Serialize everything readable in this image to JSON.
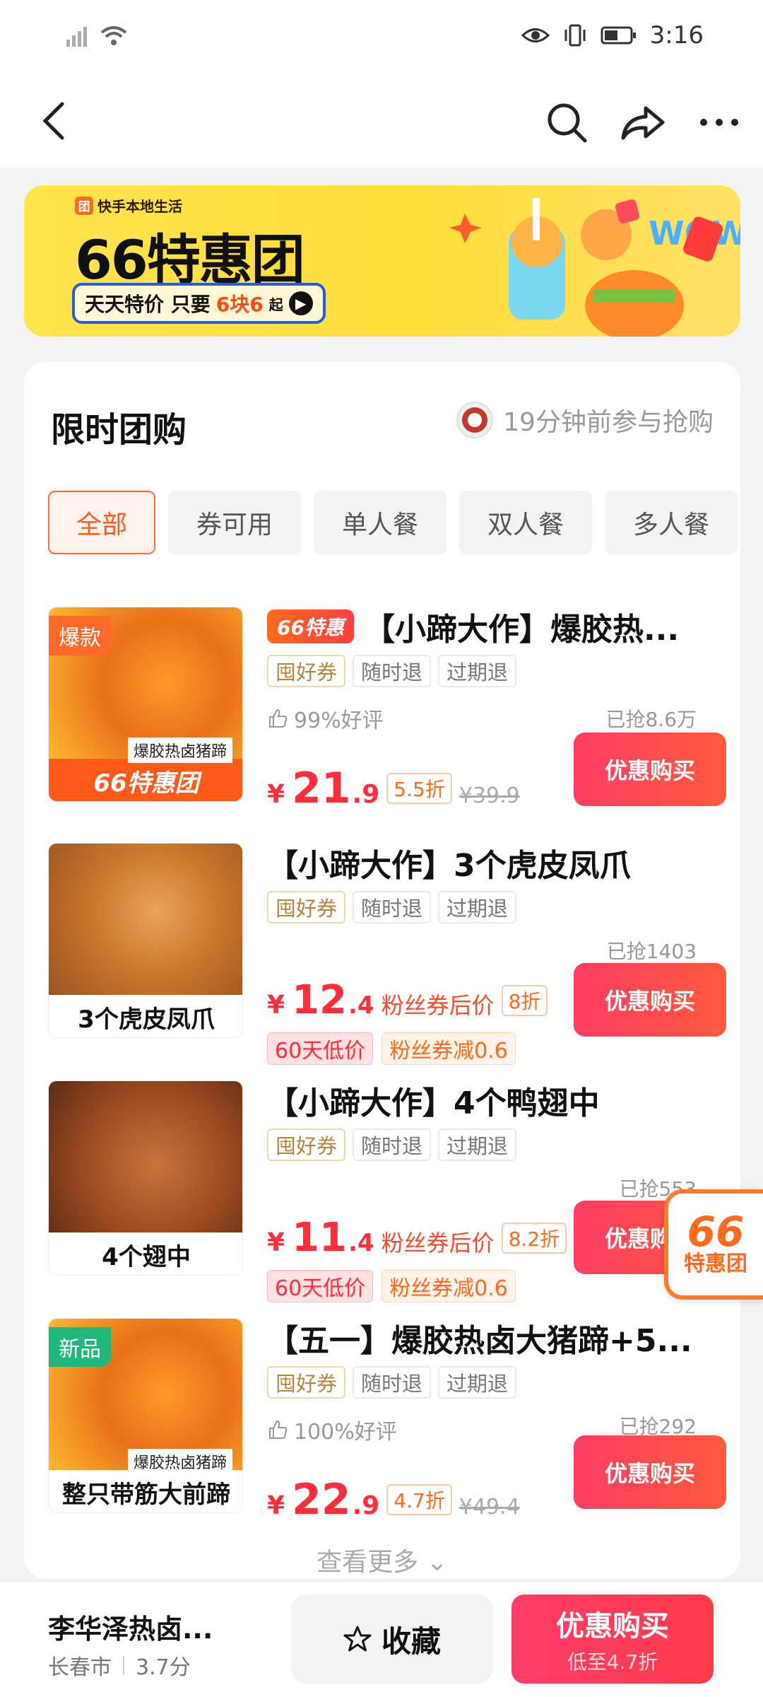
{
  "status": {
    "time": "3:16"
  },
  "banner": {
    "brand": "快手本地生活",
    "brand_icon": "团",
    "title": "66特惠团",
    "sub_prefix": "天天特价 只要",
    "sub_highlight": "6块6",
    "sub_suffix": "起"
  },
  "section": {
    "title": "限时团购",
    "recent": "19分钟前参与抢购"
  },
  "filters": [
    "全部",
    "券可用",
    "单人餐",
    "双人餐",
    "多人餐"
  ],
  "items": [
    {
      "promo": "66特惠",
      "title": "【小蹄大作】爆胶热...",
      "tags": [
        "囤好券",
        "随时退",
        "过期退"
      ],
      "rating": "99%好评",
      "grabbed": "已抢8.6万",
      "price_int": "21",
      "price_dec": ".9",
      "discount": "5.5折",
      "original": "¥39.9",
      "badge": "爆款",
      "sub_caption": "爆胶热卤猪蹄",
      "caption": "66特惠团",
      "buy": "优惠购买"
    },
    {
      "title": "【小蹄大作】3个虎皮凤爪",
      "tags": [
        "囤好券",
        "随时退",
        "过期退"
      ],
      "grabbed": "已抢1403",
      "price_int": "12",
      "price_dec": ".4",
      "fan_label": "粉丝券后价",
      "discount": "8折",
      "low": "60天低价",
      "coupon": "粉丝券减0.6",
      "caption": "3个虎皮凤爪",
      "buy": "优惠购买"
    },
    {
      "title": "【小蹄大作】4个鸭翅中",
      "tags": [
        "囤好券",
        "随时退",
        "过期退"
      ],
      "grabbed": "已抢553",
      "price_int": "11",
      "price_dec": ".4",
      "fan_label": "粉丝券后价",
      "discount": "8.2折",
      "low": "60天低价",
      "coupon": "粉丝券减0.6",
      "caption": "4个翅中",
      "buy": "优惠购买"
    },
    {
      "title": "【五一】爆胶热卤大猪蹄+5...",
      "tags": [
        "囤好券",
        "随时退",
        "过期退"
      ],
      "rating": "100%好评",
      "grabbed": "已抢292",
      "price_int": "22",
      "price_dec": ".9",
      "discount": "4.7折",
      "original": "¥49.4",
      "badge": "新品",
      "sub_caption": "爆胶热卤猪蹄",
      "caption": "整只带筋大前蹄",
      "buy": "优惠购买"
    }
  ],
  "currency": "¥",
  "more": "查看更多",
  "float_badge": {
    "num": "66",
    "text": "特惠团"
  },
  "bottom": {
    "shop_name": "李华泽热卤...",
    "city": "长春市",
    "score": "3.7分",
    "fav": "收藏",
    "buy": "优惠购买",
    "buy_sub": "低至4.7折"
  },
  "colors": {
    "accent": "#ff2e3c",
    "orange": "#ff6a1f",
    "banner_yellow": "#ffe44d"
  }
}
